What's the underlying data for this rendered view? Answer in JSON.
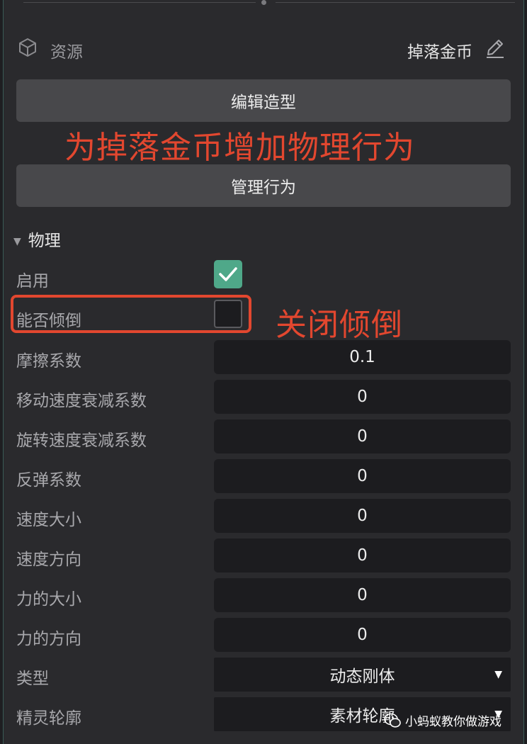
{
  "header": {
    "resource_label": "资源",
    "asset_name": "掉落金币"
  },
  "buttons": {
    "edit_shape": "编辑造型",
    "manage_behavior": "管理行为"
  },
  "annotations": {
    "top": "为掉落金币增加物理行为",
    "right": "关闭倾倒",
    "color": "#e2472f"
  },
  "section": {
    "title": "物理"
  },
  "rows": {
    "enable": {
      "label": "启用",
      "checked": true
    },
    "can_topple": {
      "label": "能否倾倒",
      "checked": false
    },
    "friction": {
      "label": "摩擦系数",
      "value": "0.1"
    },
    "linear_damping": {
      "label": "移动速度衰减系数",
      "value": "0"
    },
    "angular_damping": {
      "label": "旋转速度衰减系数",
      "value": "0"
    },
    "restitution": {
      "label": "反弹系数",
      "value": "0"
    },
    "speed_magnitude": {
      "label": "速度大小",
      "value": "0"
    },
    "speed_direction": {
      "label": "速度方向",
      "value": "0"
    },
    "force_magnitude": {
      "label": "力的大小",
      "value": "0"
    },
    "force_direction": {
      "label": "力的方向",
      "value": "0"
    },
    "type": {
      "label": "类型",
      "value": "动态刚体"
    },
    "sprite_outline": {
      "label": "精灵轮廓",
      "value": "素材轮廓"
    }
  },
  "watermark": {
    "text": "小蚂蚁教你做游戏"
  },
  "icons": {
    "resource": "cube-icon",
    "edit": "pencil-icon",
    "checkbox": "checkmark-icon",
    "dropdown": "caret-down-icon",
    "watermark": "wechat-icon"
  },
  "colors": {
    "accent_check": "#4fa889",
    "annotation": "#e2472f"
  }
}
